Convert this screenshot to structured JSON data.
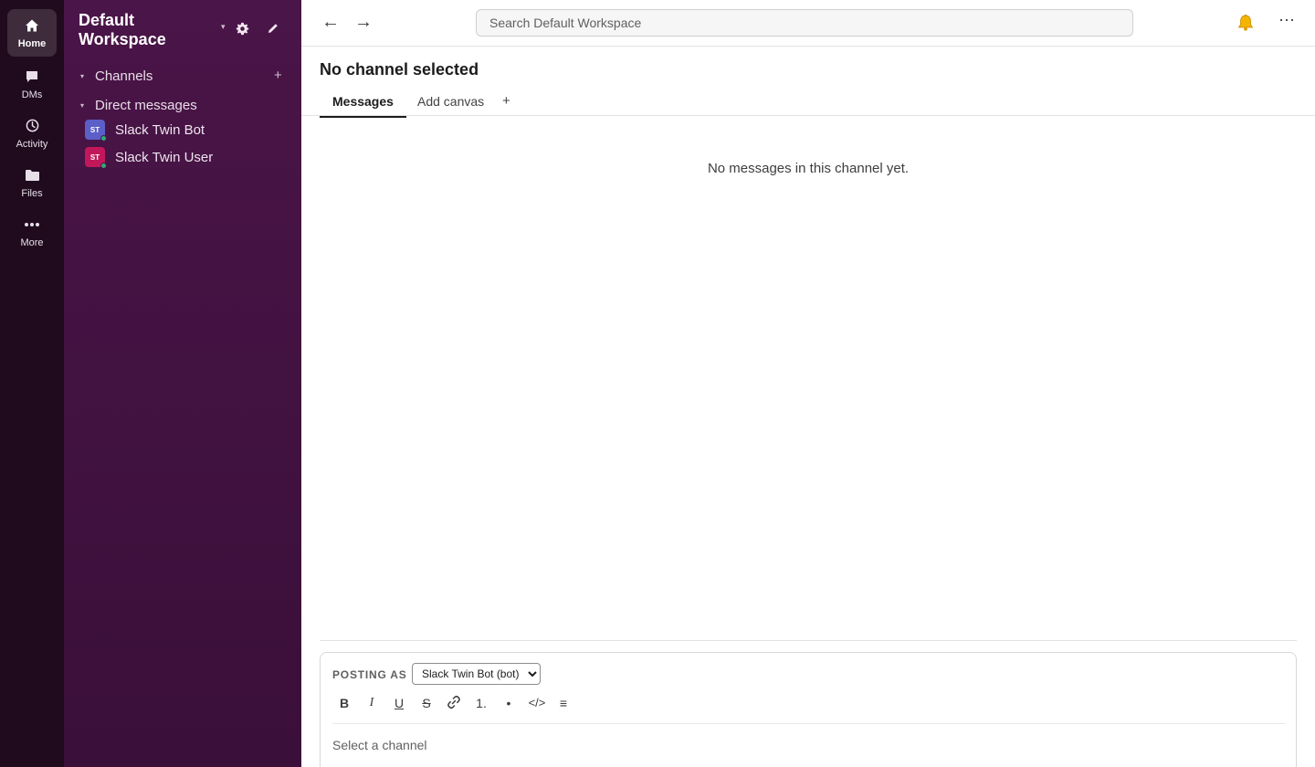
{
  "rail": {
    "items": [
      {
        "label": "Home",
        "icon": "home-icon",
        "active": true
      },
      {
        "label": "DMs",
        "icon": "chat-icon"
      },
      {
        "label": "Activity",
        "icon": "clock-icon"
      },
      {
        "label": "Files",
        "icon": "folder-icon"
      },
      {
        "label": "More",
        "icon": "more-dots-icon"
      }
    ]
  },
  "sidebar": {
    "workspace_name": "Default Workspace",
    "caret": "▾",
    "sections": [
      {
        "label": "Channels",
        "add": "+"
      },
      {
        "label": "Direct messages"
      }
    ],
    "dms": [
      {
        "initials": "ST",
        "name": "Slack Twin Bot",
        "color": "#5b5fc7"
      },
      {
        "initials": "ST",
        "name": "Slack Twin User",
        "color": "#c2185b"
      }
    ]
  },
  "topbar": {
    "back": "←",
    "forward": "→",
    "search_placeholder": "Search Default Workspace",
    "more": "⋯"
  },
  "channel": {
    "title": "No channel selected",
    "tabs": [
      "Messages",
      "Add canvas"
    ],
    "tab_add": "+",
    "empty_text": "No messages in this channel yet."
  },
  "composer": {
    "posting_as_label": "POSTING AS",
    "posting_as_value": "Slack Twin Bot (bot)",
    "format_buttons": [
      "B",
      "I",
      "U",
      "S",
      "link",
      "1.",
      "•",
      "</>",
      "≡"
    ],
    "input_placeholder": "Select a channel"
  },
  "colors": {
    "rail_bg": "#1f0a1e",
    "sidebar_bg": "#4a1548",
    "presence": "#2bac76"
  }
}
